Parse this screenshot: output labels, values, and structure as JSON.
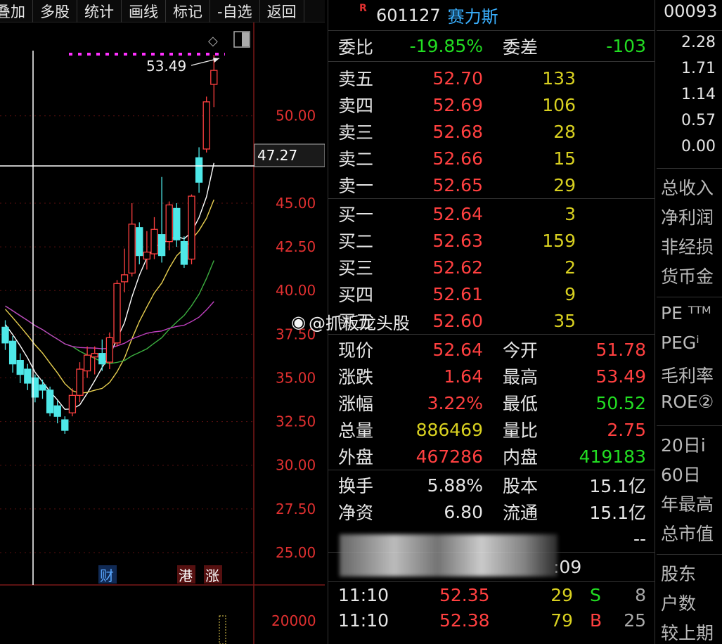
{
  "toolbar": {
    "items": [
      "叠加",
      "多股",
      "统计",
      "画线",
      "标记",
      "-自选",
      "返回"
    ]
  },
  "chart": {
    "price_axis": [
      "50.00",
      "45.00",
      "42.50",
      "40.00",
      "37.50",
      "35.00",
      "32.50",
      "30.00",
      "27.50",
      "25.00"
    ],
    "high_marker": "53.49",
    "cursor_price": "47.27",
    "volume_label": "20000",
    "tags": [
      "财",
      "港",
      "涨"
    ],
    "colors": {
      "up": "#ff4040",
      "down": "#4ee8e8",
      "ma5": "#ffffff",
      "ma10": "#e8d050",
      "ma20": "#3cb040",
      "ma60": "#c040c0"
    }
  },
  "chart_data": {
    "type": "candlestick",
    "ylim": [
      25,
      53.49
    ],
    "candles": [
      {
        "o": 37.9,
        "c": 37.0,
        "h": 38.3,
        "l": 36.6
      },
      {
        "o": 37.1,
        "c": 35.8,
        "h": 37.4,
        "l": 35.3
      },
      {
        "o": 36.0,
        "c": 35.2,
        "h": 36.4,
        "l": 34.7
      },
      {
        "o": 35.5,
        "c": 34.7,
        "h": 35.8,
        "l": 34.3
      },
      {
        "o": 35.0,
        "c": 33.9,
        "h": 35.2,
        "l": 33.6
      },
      {
        "o": 34.6,
        "c": 34.3,
        "h": 34.9,
        "l": 33.8
      },
      {
        "o": 34.3,
        "c": 33.0,
        "h": 34.5,
        "l": 32.8
      },
      {
        "o": 33.4,
        "c": 32.8,
        "h": 33.7,
        "l": 32.4
      },
      {
        "o": 32.6,
        "c": 32.0,
        "h": 32.8,
        "l": 31.8
      },
      {
        "o": 33.0,
        "c": 34.0,
        "h": 34.4,
        "l": 32.8
      },
      {
        "o": 34.0,
        "c": 35.5,
        "h": 35.9,
        "l": 33.6
      },
      {
        "o": 35.4,
        "c": 36.3,
        "h": 36.8,
        "l": 35.0
      },
      {
        "o": 36.2,
        "c": 36.4,
        "h": 36.8,
        "l": 35.2
      },
      {
        "o": 36.4,
        "c": 35.8,
        "h": 37.2,
        "l": 35.4
      },
      {
        "o": 35.9,
        "c": 37.3,
        "h": 37.6,
        "l": 35.5
      },
      {
        "o": 37.0,
        "c": 40.4,
        "h": 40.6,
        "l": 36.8
      },
      {
        "o": 40.5,
        "c": 40.9,
        "h": 42.4,
        "l": 39.9
      },
      {
        "o": 41.0,
        "c": 43.8,
        "h": 45.0,
        "l": 40.8
      },
      {
        "o": 43.6,
        "c": 42.0,
        "h": 43.9,
        "l": 41.5
      },
      {
        "o": 41.8,
        "c": 42.2,
        "h": 43.4,
        "l": 41.2
      },
      {
        "o": 42.1,
        "c": 43.5,
        "h": 44.2,
        "l": 41.8
      },
      {
        "o": 43.2,
        "c": 42.0,
        "h": 46.5,
        "l": 41.6
      },
      {
        "o": 42.8,
        "c": 44.9,
        "h": 45.1,
        "l": 42.3
      },
      {
        "o": 44.7,
        "c": 42.9,
        "h": 45.0,
        "l": 42.5
      },
      {
        "o": 42.8,
        "c": 41.5,
        "h": 43.1,
        "l": 41.3
      },
      {
        "o": 41.8,
        "c": 45.4,
        "h": 45.5,
        "l": 41.5
      },
      {
        "o": 47.6,
        "c": 46.2,
        "h": 48.2,
        "l": 45.6
      },
      {
        "o": 48.1,
        "c": 50.8,
        "h": 51.1,
        "l": 47.9
      },
      {
        "o": 51.8,
        "c": 52.6,
        "h": 53.49,
        "l": 50.5
      }
    ]
  },
  "header": {
    "mark": "R",
    "code": "601127",
    "name": "赛力斯"
  },
  "weibi": {
    "label1": "委比",
    "value1": "-19.85%",
    "label2": "委差",
    "value2": "-103"
  },
  "asks": [
    {
      "label": "卖五",
      "price": "52.70",
      "vol": "133"
    },
    {
      "label": "卖四",
      "price": "52.69",
      "vol": "106"
    },
    {
      "label": "卖三",
      "price": "52.68",
      "vol": "28"
    },
    {
      "label": "卖二",
      "price": "52.66",
      "vol": "15"
    },
    {
      "label": "卖一",
      "price": "52.65",
      "vol": "29"
    }
  ],
  "bids": [
    {
      "label": "买一",
      "price": "52.64",
      "vol": "3"
    },
    {
      "label": "买二",
      "price": "52.63",
      "vol": "159"
    },
    {
      "label": "买三",
      "price": "52.62",
      "vol": "2"
    },
    {
      "label": "买四",
      "price": "52.61",
      "vol": "9"
    },
    {
      "label": "买五",
      "price": "52.60",
      "vol": "35"
    }
  ],
  "stats": [
    {
      "l1": "现价",
      "v1": "52.64",
      "c1": "red",
      "l2": "今开",
      "v2": "51.78",
      "c2": "red"
    },
    {
      "l1": "涨跌",
      "v1": "1.64",
      "c1": "red",
      "l2": "最高",
      "v2": "53.49",
      "c2": "red"
    },
    {
      "l1": "涨幅",
      "v1": "3.22%",
      "c1": "red",
      "l2": "最低",
      "v2": "50.52",
      "c2": "green"
    },
    {
      "l1": "总量",
      "v1": "886469",
      "c1": "yellow",
      "l2": "量比",
      "v2": "2.75",
      "c2": "red"
    },
    {
      "l1": "外盘",
      "v1": "467286",
      "c1": "red",
      "l2": "内盘",
      "v2": "419183",
      "c2": "green"
    }
  ],
  "stats2": [
    {
      "l1": "换手",
      "v1": "5.88%",
      "l2": "股本",
      "v2": "15.1亿"
    },
    {
      "l1": "净资",
      "v1": "6.80",
      "l2": "流通",
      "v2": "15.1亿"
    }
  ],
  "partial_row": {
    "value": "--",
    "time_fragment": ":09"
  },
  "ticks": [
    {
      "time": "11:10",
      "price": "52.35",
      "vol": "29",
      "bs": "S",
      "n": "8"
    },
    {
      "time": "11:10",
      "price": "52.38",
      "vol": "79",
      "bs": "B",
      "n": "25"
    }
  ],
  "watermark": "@抓板龙头股",
  "sidebar": {
    "code": "00093",
    "values": [
      "2.28",
      "1.71",
      "1.14",
      "0.57",
      "0.00"
    ],
    "labels_a": [
      "总收入",
      "净利润",
      "非经损",
      "货币金"
    ],
    "labels_b": [
      "PE ᵀᵀᴹ",
      "PEGⁱ",
      "毛利率",
      "ROE②"
    ],
    "labels_c": [
      "20日i",
      "60日",
      "年最高",
      "总市值"
    ],
    "labels_d": [
      "股东",
      "户数",
      "较上期"
    ]
  }
}
